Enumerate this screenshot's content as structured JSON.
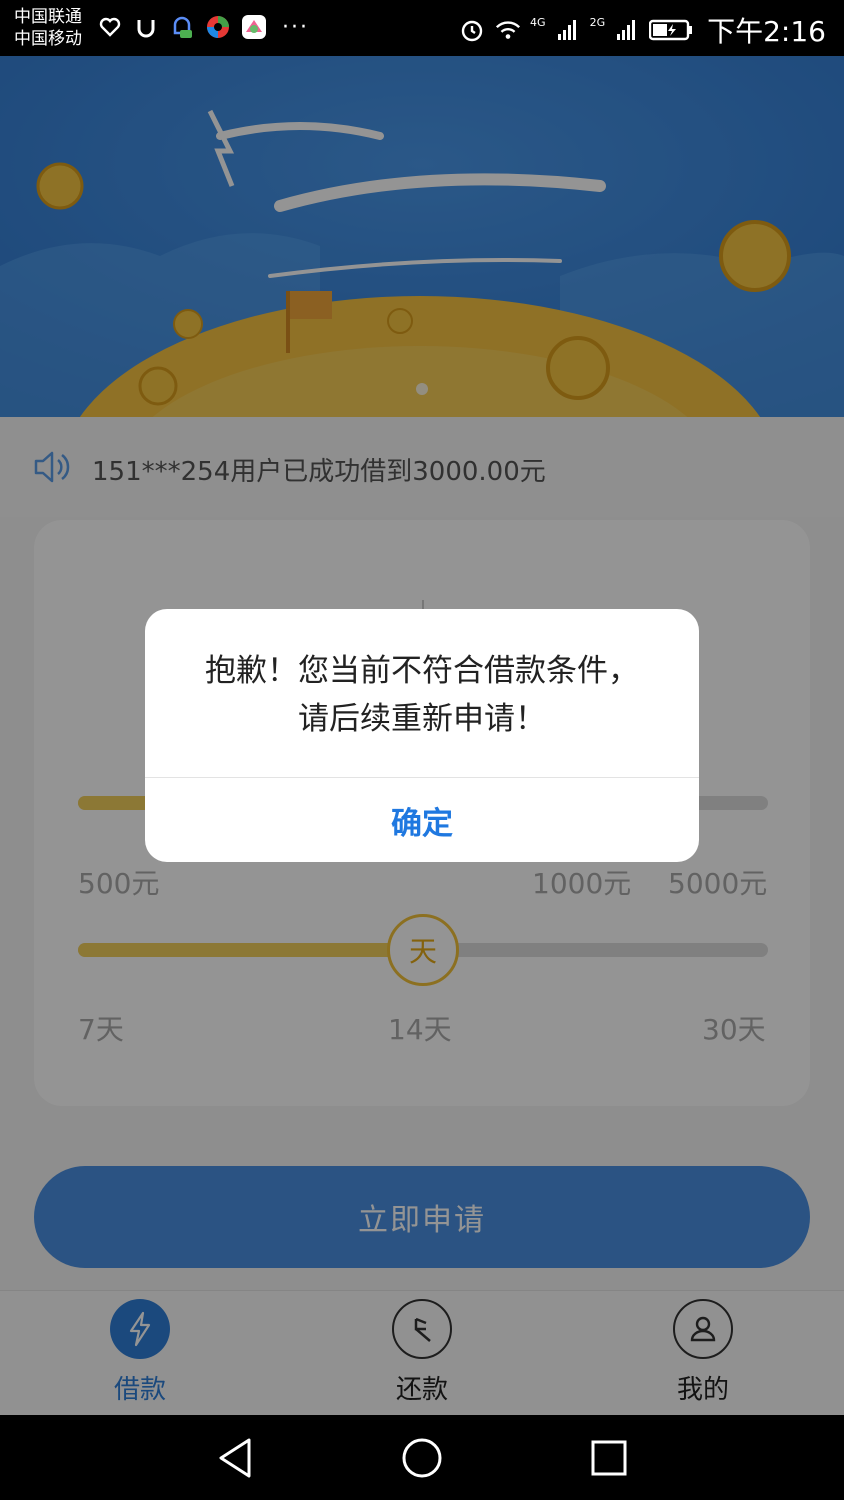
{
  "status_bar": {
    "carrier1": "中国联通",
    "carrier2": "中国移动",
    "net1": "4G",
    "net2": "2G",
    "time": "下午2:16"
  },
  "notice": {
    "text": "151***254用户已成功借到3000.00元"
  },
  "amount_slider": {
    "labels": [
      "500元",
      "1000元",
      "5000元"
    ],
    "value": "1000元"
  },
  "term_slider": {
    "labels": [
      "7天",
      "14天",
      "30天"
    ],
    "knob_label": "天",
    "value": "14天"
  },
  "apply_button": {
    "label": "立即申请"
  },
  "tabs": [
    {
      "label": "借款",
      "icon": "lightning-icon",
      "active": true
    },
    {
      "label": "还款",
      "icon": "repay-arrow-icon",
      "active": false
    },
    {
      "label": "我的",
      "icon": "user-icon",
      "active": false
    }
  ],
  "dialog": {
    "message": "抱歉！您当前不符合借款条件，请后续重新申请！",
    "confirm_label": "确定"
  },
  "colors": {
    "accent": "#1f78e0",
    "banner": "#3a87dc",
    "gold": "#f2c23a"
  }
}
